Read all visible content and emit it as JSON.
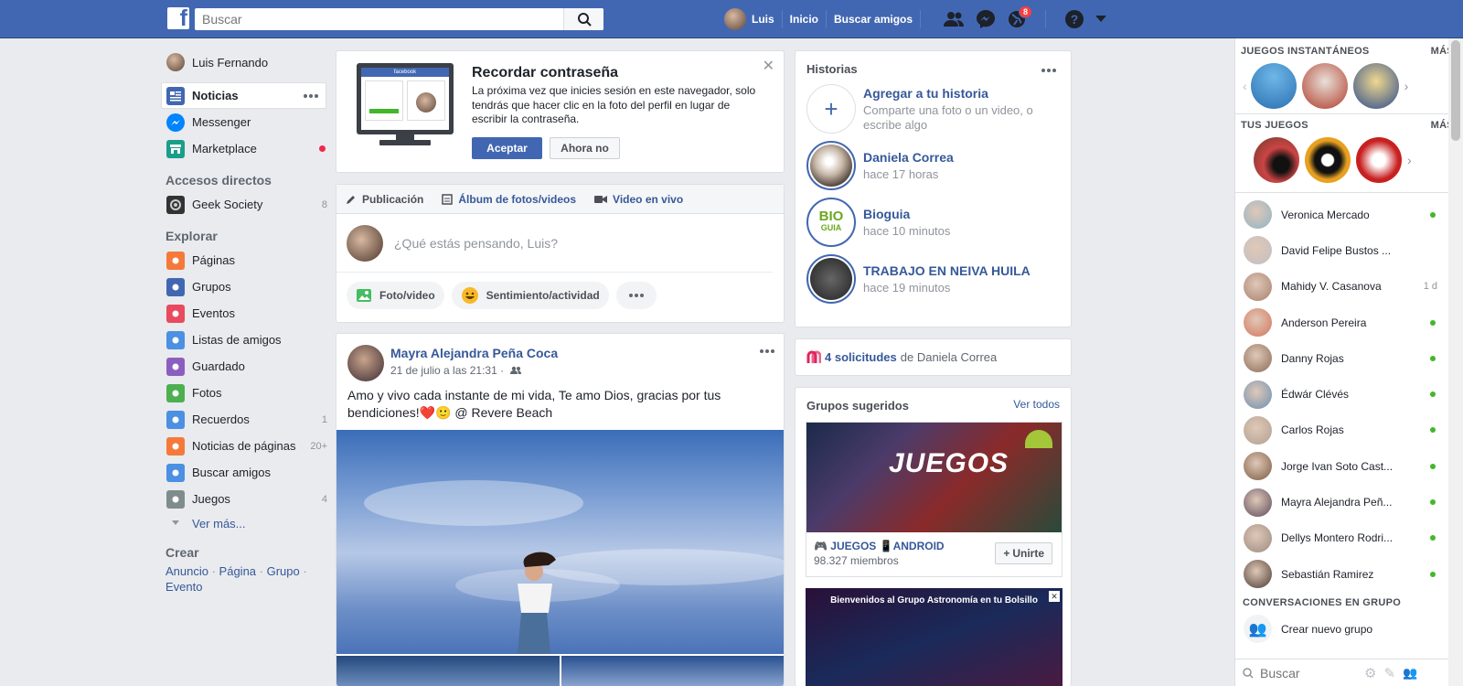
{
  "topbar": {
    "search_placeholder": "Buscar",
    "user_name": "Luis",
    "links": [
      "Inicio",
      "Buscar amigos"
    ],
    "notification_count": "8"
  },
  "leftnav": {
    "profile_name": "Luis Fernando",
    "main": [
      {
        "label": "Noticias",
        "icon": "news-feed-icon",
        "color": "#4267b2"
      },
      {
        "label": "Messenger",
        "icon": "messenger-icon",
        "color": "#0084ff"
      },
      {
        "label": "Marketplace",
        "icon": "marketplace-icon",
        "color": "#1a9e8a"
      }
    ],
    "shortcuts_heading": "Accesos directos",
    "shortcuts": [
      {
        "label": "Geek Society",
        "count": "8"
      }
    ],
    "explore_heading": "Explorar",
    "explore": [
      {
        "label": "Páginas",
        "count": "",
        "icon": "flag-icon",
        "color": "#f5793b"
      },
      {
        "label": "Grupos",
        "count": "",
        "icon": "groups-icon",
        "color": "#4267b2"
      },
      {
        "label": "Eventos",
        "count": "",
        "icon": "calendar-icon",
        "color": "#e84a5f"
      },
      {
        "label": "Listas de amigos",
        "count": "",
        "icon": "friend-list-icon",
        "color": "#4b90e2"
      },
      {
        "label": "Guardado",
        "count": "",
        "icon": "bookmark-icon",
        "color": "#8b5fbf"
      },
      {
        "label": "Fotos",
        "count": "",
        "icon": "photos-icon",
        "color": "#4caf50"
      },
      {
        "label": "Recuerdos",
        "count": "1",
        "icon": "clock-icon",
        "color": "#4b90e2"
      },
      {
        "label": "Noticias de páginas",
        "count": "20+",
        "icon": "page-feed-icon",
        "color": "#f5793b"
      },
      {
        "label": "Buscar amigos",
        "count": "",
        "icon": "find-friends-icon",
        "color": "#4b90e2"
      },
      {
        "label": "Juegos",
        "count": "4",
        "icon": "gamepad-icon",
        "color": "#7f8c8d"
      }
    ],
    "see_more": "Ver más...",
    "create_heading": "Crear",
    "create_links": [
      "Anuncio",
      "Página",
      "Grupo",
      "Evento"
    ]
  },
  "remember": {
    "title": "Recordar contraseña",
    "body": "La próxima vez que inicies sesión en este navegador, solo tendrás que hacer clic en la foto del perfil en lugar de escribir la contraseña.",
    "accept": "Aceptar",
    "decline": "Ahora no"
  },
  "composer": {
    "tabs": [
      "Publicación",
      "Álbum de fotos/videos",
      "Video en vivo"
    ],
    "placeholder": "¿Qué estás pensando, Luis?",
    "actions": [
      "Foto/video",
      "Sentimiento/actividad"
    ]
  },
  "post": {
    "author": "Mayra Alejandra Peña Coca",
    "time": "21 de julio a las 21:31 ·",
    "text": "Amo y vivo cada instante de mi vida, Te amo Dios, gracias por tus bendiciones!❤️🙂 @ Revere Beach"
  },
  "stories": {
    "heading": "Historias",
    "add_title": "Agregar a tu historia",
    "add_sub": "Comparte una foto o un video, o escribe algo",
    "items": [
      {
        "name": "Daniela Correa",
        "time": "hace 17 horas",
        "color": "#7a6a5a"
      },
      {
        "name": "Bioguia",
        "time": "hace 10 minutos",
        "color": "#ffffff"
      },
      {
        "name": "TRABAJO EN NEIVA HUILA",
        "time": "hace 19 minutos",
        "color": "#333333"
      }
    ]
  },
  "requests": {
    "count_text": "4 solicitudes",
    "from_text": "de Daniela Correa"
  },
  "groups": {
    "heading": "Grupos sugeridos",
    "see_all": "Ver todos",
    "banner_text": "JUEGOS",
    "name": "🎮 JUEGOS 📱ANDROID",
    "members": "98.327 miembros",
    "join": "Unirte",
    "second_banner": "Bienvenidos al Grupo Astronomía en tu Bolsillo"
  },
  "rightbar": {
    "instant_games": "JUEGOS INSTANTÁNEOS",
    "your_games": "TUS JUEGOS",
    "more": "MÁS",
    "contacts": [
      {
        "name": "Veronica Mercado",
        "status": "online",
        "ago": "",
        "color": "#8fb3c4"
      },
      {
        "name": "David Felipe Bustos ...",
        "status": "none",
        "ago": "",
        "color": "#c0c0c0"
      },
      {
        "name": "Mahidy V. Casanova",
        "status": "away",
        "ago": "1 d",
        "color": "#a77f6b"
      },
      {
        "name": "Anderson Pereira",
        "status": "online",
        "ago": "",
        "color": "#d4745a"
      },
      {
        "name": "Danny Rojas",
        "status": "online",
        "ago": "",
        "color": "#8a6a55"
      },
      {
        "name": "Édwár Clévés",
        "status": "online",
        "ago": "",
        "color": "#6a8fb0"
      },
      {
        "name": "Carlos Rojas",
        "status": "online",
        "ago": "",
        "color": "#b0a090"
      },
      {
        "name": "Jorge Ivan Soto Cast...",
        "status": "online",
        "ago": "",
        "color": "#7a5a40"
      },
      {
        "name": "Mayra Alejandra Peñ...",
        "status": "online",
        "ago": "",
        "color": "#5a4a5a"
      },
      {
        "name": "Dellys Montero Rodri...",
        "status": "online",
        "ago": "",
        "color": "#9a8a80"
      },
      {
        "name": "Sebastián Ramirez",
        "status": "online",
        "ago": "",
        "color": "#4a3a30"
      }
    ],
    "group_convos": "CONVERSACIONES EN GRUPO",
    "create_group": "Crear nuevo grupo",
    "search_placeholder": "Buscar"
  }
}
